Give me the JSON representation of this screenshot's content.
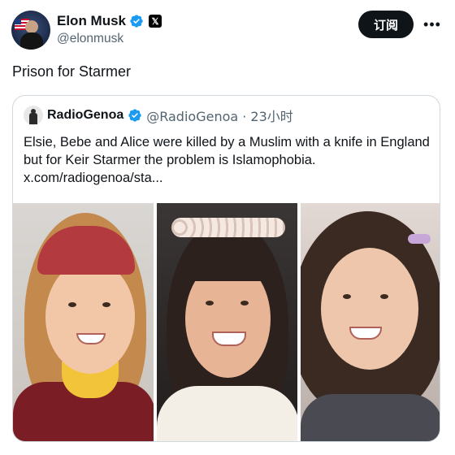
{
  "post": {
    "author_name": "Elon Musk",
    "handle": "@elonmusk",
    "subscribe_label": "订阅",
    "text": "Prison for Starmer",
    "verified_color": "#1d9bf0"
  },
  "quote": {
    "author_name": "RadioGenoa",
    "meta": "@RadioGenoa · 23小时",
    "text": "Elsie, Bebe and Alice were killed by a Muslim with a knife in England but for Keir Starmer the problem is Islamophobia.",
    "link": "x.com/radiogenoa/sta..."
  },
  "icons": {
    "verified": "verified-badge-icon",
    "x_logo": "x-logo-icon",
    "more": "more-icon"
  }
}
